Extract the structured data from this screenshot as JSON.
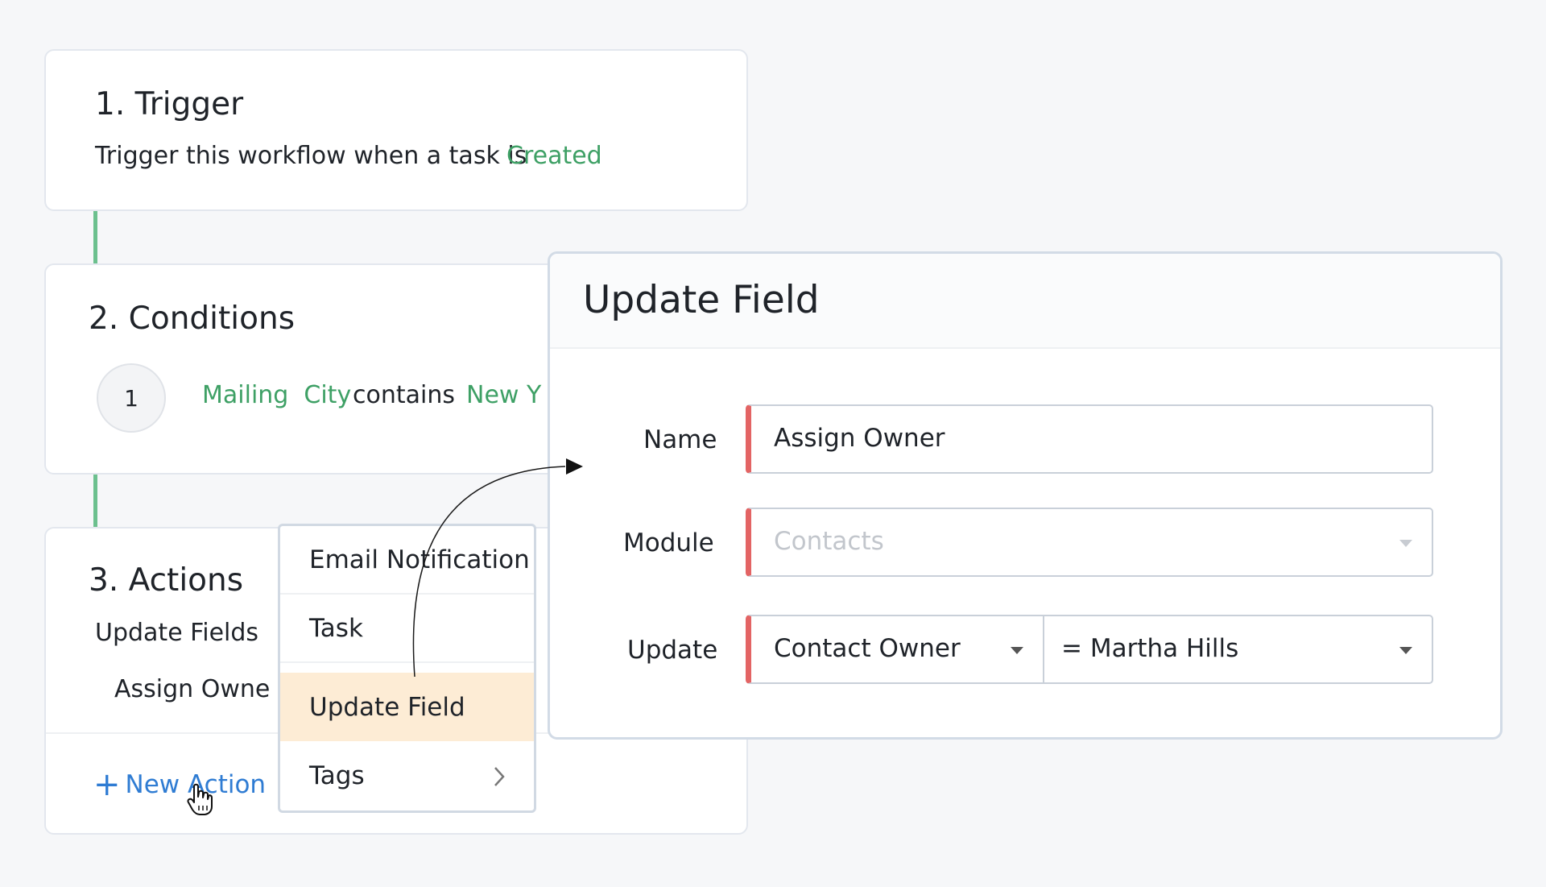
{
  "trigger": {
    "title": "1. Trigger",
    "text": "Trigger this workflow when a task is",
    "event": "Created"
  },
  "conditions": {
    "title": "2. Conditions",
    "index": "1",
    "field": "Mailing  City",
    "operator": "contains",
    "value": "New Y"
  },
  "actions": {
    "title": "3. Actions",
    "group_label": "Update Fields",
    "item_label": "Assign Owne",
    "new_action_label": "New Action"
  },
  "menu": {
    "items": [
      {
        "label": "Email Notification"
      },
      {
        "label": "Task"
      },
      {
        "label": "Update Field"
      },
      {
        "label": "Tags"
      }
    ],
    "selected": "Update Field"
  },
  "panel": {
    "title": "Update Field",
    "name_label": "Name",
    "name_value": "Assign Owner",
    "module_label": "Module",
    "module_placeholder": "Contacts",
    "update_label": "Update",
    "update_field": "Contact Owner",
    "update_value": "= Martha Hills"
  },
  "icons": {
    "plus": "plus-icon",
    "chevron": "chevron-right-icon",
    "dropdown": "chevron-down-icon",
    "cursor": "hand-pointer-icon",
    "arrow": "connector-arrow"
  },
  "colors": {
    "accent_green": "#3ea065",
    "link_blue": "#2f7cd3",
    "required_red": "#e36464",
    "highlight": "#fdecd5"
  }
}
